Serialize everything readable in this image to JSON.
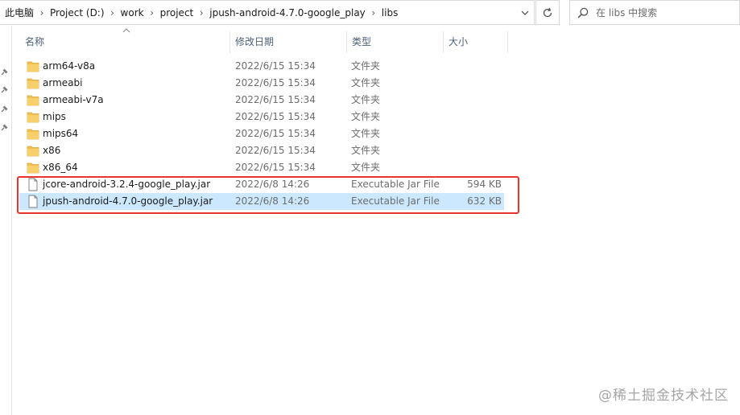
{
  "breadcrumb": [
    "此电脑",
    "Project (D:)",
    "work",
    "project",
    "jpush-android-4.7.0-google_play",
    "libs"
  ],
  "search": {
    "placeholder": "在 libs 中搜索"
  },
  "columns": {
    "name": "名称",
    "date": "修改日期",
    "type": "类型",
    "size": "大小"
  },
  "files": [
    {
      "name": "arm64-v8a",
      "date": "2022/6/15 15:34",
      "type": "文件夹",
      "size": "",
      "icon": "folder-icon"
    },
    {
      "name": "armeabi",
      "date": "2022/6/15 15:34",
      "type": "文件夹",
      "size": "",
      "icon": "folder-icon"
    },
    {
      "name": "armeabi-v7a",
      "date": "2022/6/15 15:34",
      "type": "文件夹",
      "size": "",
      "icon": "folder-icon"
    },
    {
      "name": "mips",
      "date": "2022/6/15 15:34",
      "type": "文件夹",
      "size": "",
      "icon": "folder-icon"
    },
    {
      "name": "mips64",
      "date": "2022/6/15 15:34",
      "type": "文件夹",
      "size": "",
      "icon": "folder-icon"
    },
    {
      "name": "x86",
      "date": "2022/6/15 15:34",
      "type": "文件夹",
      "size": "",
      "icon": "folder-icon"
    },
    {
      "name": "x86_64",
      "date": "2022/6/15 15:34",
      "type": "文件夹",
      "size": "",
      "icon": "folder-icon"
    },
    {
      "name": "jcore-android-3.2.4-google_play.jar",
      "date": "2022/6/8 14:26",
      "type": "Executable Jar File",
      "size": "594 KB",
      "icon": "jar-file-icon"
    },
    {
      "name": "jpush-android-4.7.0-google_play.jar",
      "date": "2022/6/8 14:26",
      "type": "Executable Jar File",
      "size": "632 KB",
      "icon": "jar-file-icon",
      "selected": true
    }
  ],
  "watermark": "@稀土掘金技术社区",
  "colors": {
    "selection": "#cce8ff",
    "highlight": "#e8352c",
    "folder": "#f2c14e",
    "header_text": "#4c607a"
  }
}
